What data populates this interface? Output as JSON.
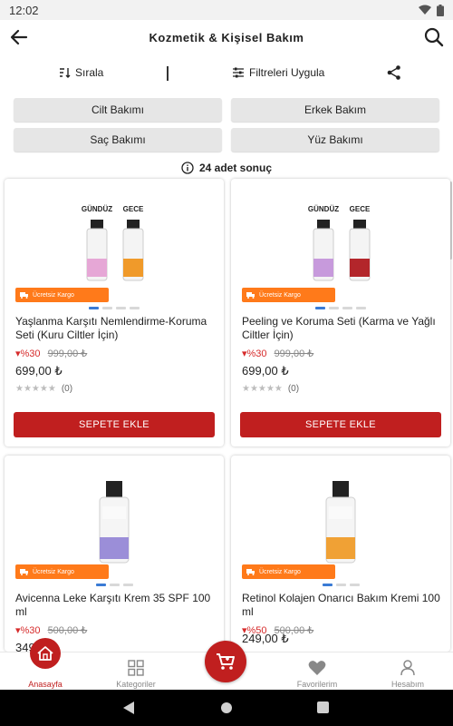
{
  "status": {
    "time": "12:02"
  },
  "header": {
    "title": "Kozmetik & Kişisel Bakım"
  },
  "toolbar": {
    "sort_label": "Sırala",
    "filter_label": "Filtreleri Uygula"
  },
  "categories": [
    "Cilt Bakımı",
    "Erkek Bakım",
    "Saç Bakımı",
    "Yüz Bakımı"
  ],
  "result_text": "24 adet sonuç",
  "products": [
    {
      "image_labels": [
        "GÜNDÜZ",
        "GECE"
      ],
      "badge": "Ücretsiz Kargo",
      "name": "Yaşlanma Karşıtı Nemlendirme-Koruma Seti (Kuru Ciltler İçin)",
      "discount": "%30",
      "old_price": "999,00 ₺",
      "price": "699,00 ₺",
      "rating_count": "(0)",
      "button": "SEPETE EKLE",
      "bottle_colors": [
        "#e6a7d6",
        "#f09a2a"
      ]
    },
    {
      "image_labels": [
        "GÜNDÜZ",
        "GECE"
      ],
      "badge": "Ücretsiz Kargo",
      "name": "Peeling ve Koruma Seti (Karma ve Yağlı Ciltler İçin)",
      "discount": "%30",
      "old_price": "999,00 ₺",
      "price": "699,00 ₺",
      "rating_count": "(0)",
      "button": "SEPETE EKLE",
      "bottle_colors": [
        "#c79adc",
        "#b3262b"
      ]
    },
    {
      "badge": "Ücretsiz Kargo",
      "name": "Avicenna Leke Karşıtı Krem 35 SPF 100 ml",
      "discount": "%30",
      "old_price": "500,00 ₺",
      "price": "349",
      "bottle_colors": [
        "#9b8ed8"
      ]
    },
    {
      "badge": "Ücretsiz Kargo",
      "name": "Retinol Kolajen Onarıcı Bakım Kremi 100 ml",
      "discount": "%50",
      "old_price": "500,00 ₺",
      "price": "249,00 ₺",
      "bottle_colors": [
        "#f0a135"
      ]
    }
  ],
  "nav": {
    "home": "Anasayfa",
    "categories": "Kategoriler",
    "favorites": "Favorilerim",
    "account": "Hesabım"
  },
  "colors": {
    "accent": "#c01f1f",
    "badge": "#ff7a1a",
    "discount": "#d62b2b"
  }
}
